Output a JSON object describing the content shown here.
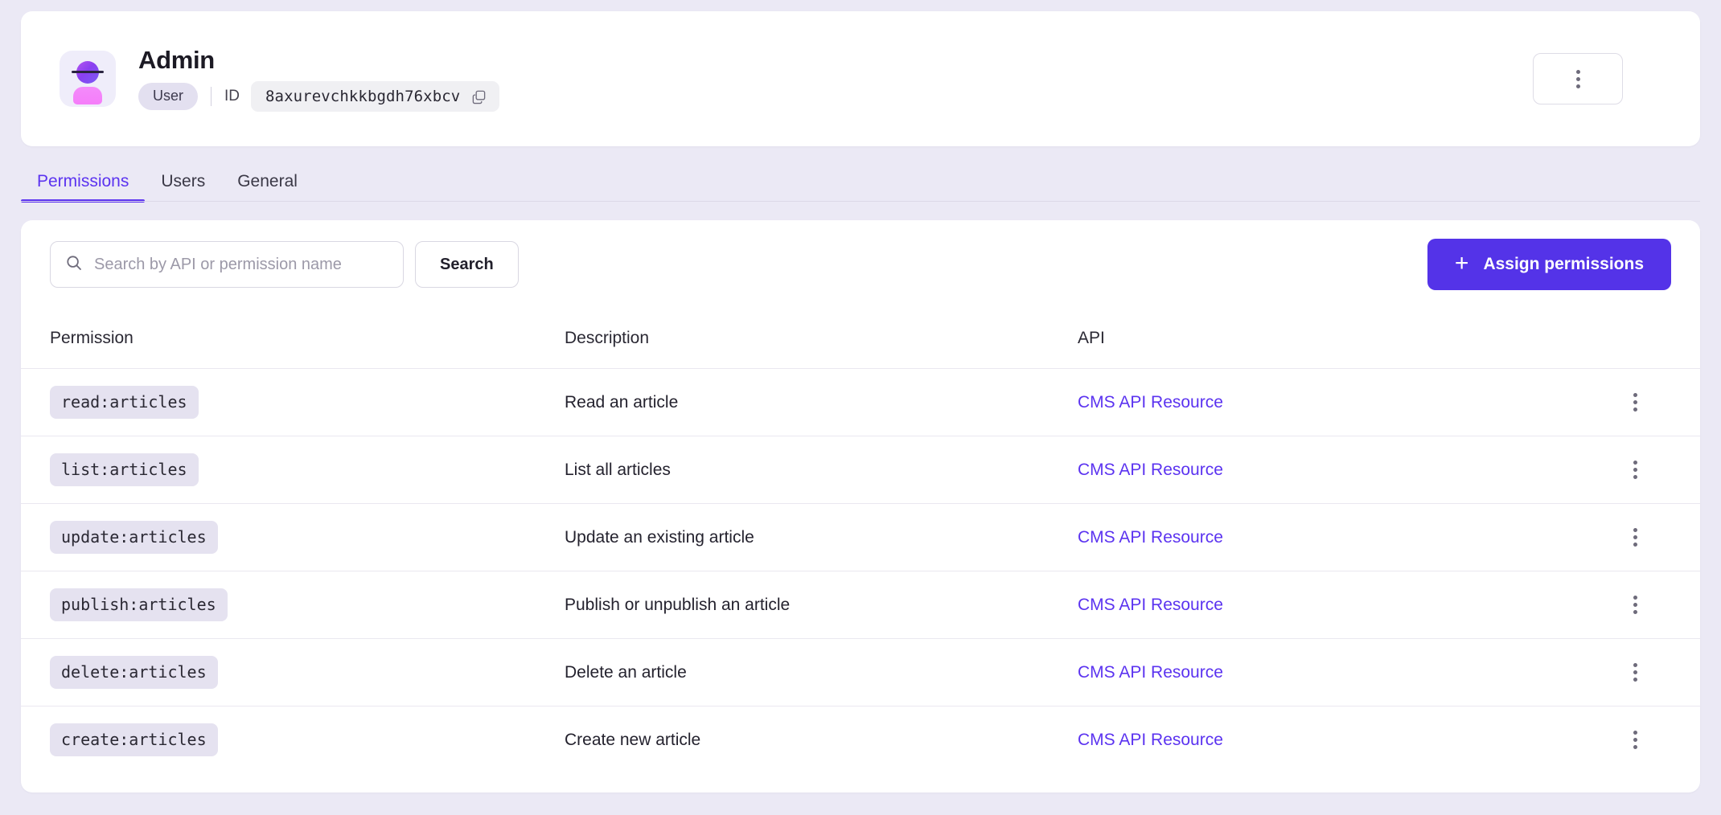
{
  "header": {
    "title": "Admin",
    "role_badge": "User",
    "id_label": "ID",
    "id_value": "8axurevchkkbgdh76xbcv",
    "copy_icon": "copy-icon",
    "avatar_icon": "user-avatar-icon",
    "overflow_icon": "kebab-menu-icon"
  },
  "tabs": [
    {
      "label": "Permissions",
      "active": true
    },
    {
      "label": "Users",
      "active": false
    },
    {
      "label": "General",
      "active": false
    }
  ],
  "toolbar": {
    "search_placeholder": "Search by API or permission name",
    "search_value": "",
    "search_icon": "search-icon",
    "search_button": "Search",
    "assign_button": "Assign permissions",
    "assign_icon": "plus-icon"
  },
  "table": {
    "columns": [
      "Permission",
      "Description",
      "API"
    ],
    "row_action_icon": "kebab-menu-icon",
    "rows": [
      {
        "permission": "read:articles",
        "description": "Read an article",
        "api": "CMS API Resource"
      },
      {
        "permission": "list:articles",
        "description": "List all articles",
        "api": "CMS API Resource"
      },
      {
        "permission": "update:articles",
        "description": "Update an existing article",
        "api": "CMS API Resource"
      },
      {
        "permission": "publish:articles",
        "description": "Publish or unpublish an article",
        "api": "CMS API Resource"
      },
      {
        "permission": "delete:articles",
        "description": "Delete an article",
        "api": "CMS API Resource"
      },
      {
        "permission": "create:articles",
        "description": "Create new article",
        "api": "CMS API Resource"
      }
    ]
  },
  "colors": {
    "accent": "#5433E8",
    "link": "#5B33F0",
    "page_bg": "#EBE9F5",
    "chip_bg": "#E5E2F0"
  }
}
